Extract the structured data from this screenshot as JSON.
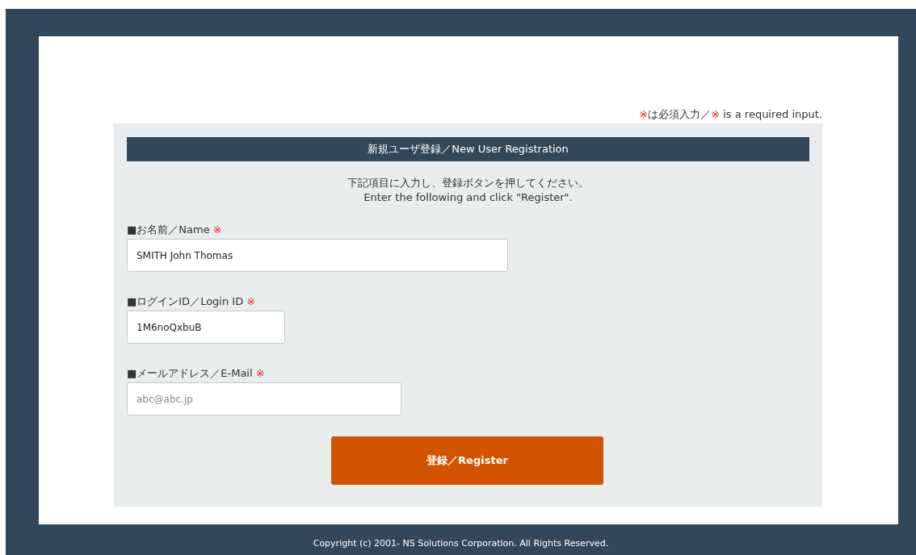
{
  "required_note": {
    "parts": [
      {
        "kind": "mark",
        "text": "※"
      },
      {
        "kind": "text",
        "text": "は必須入力／"
      },
      {
        "kind": "mark",
        "text": "※"
      },
      {
        "kind": "text",
        "text": " is a required input."
      }
    ]
  },
  "form": {
    "title": "新規ユーザ登録／New User Registration",
    "instructions": [
      "下記項目に入力し、登録ボタンを押してください。",
      "Enter the following and click \"Register\"."
    ],
    "fields": [
      {
        "label": "■お名前／Name",
        "required_mark": "※",
        "value": "SMITH John Thomas"
      },
      {
        "label": "■ログインID／Login ID",
        "required_mark": "※",
        "value": "1M6noQxbuB"
      },
      {
        "label": "■メールアドレス／E-Mail",
        "required_mark": "※",
        "placeholder": "abc@abc.jp"
      }
    ],
    "submit": "登録／Register"
  },
  "footer": "Copyright (c) 2001- NS Solutions Corporation. All Rights Reserved."
}
